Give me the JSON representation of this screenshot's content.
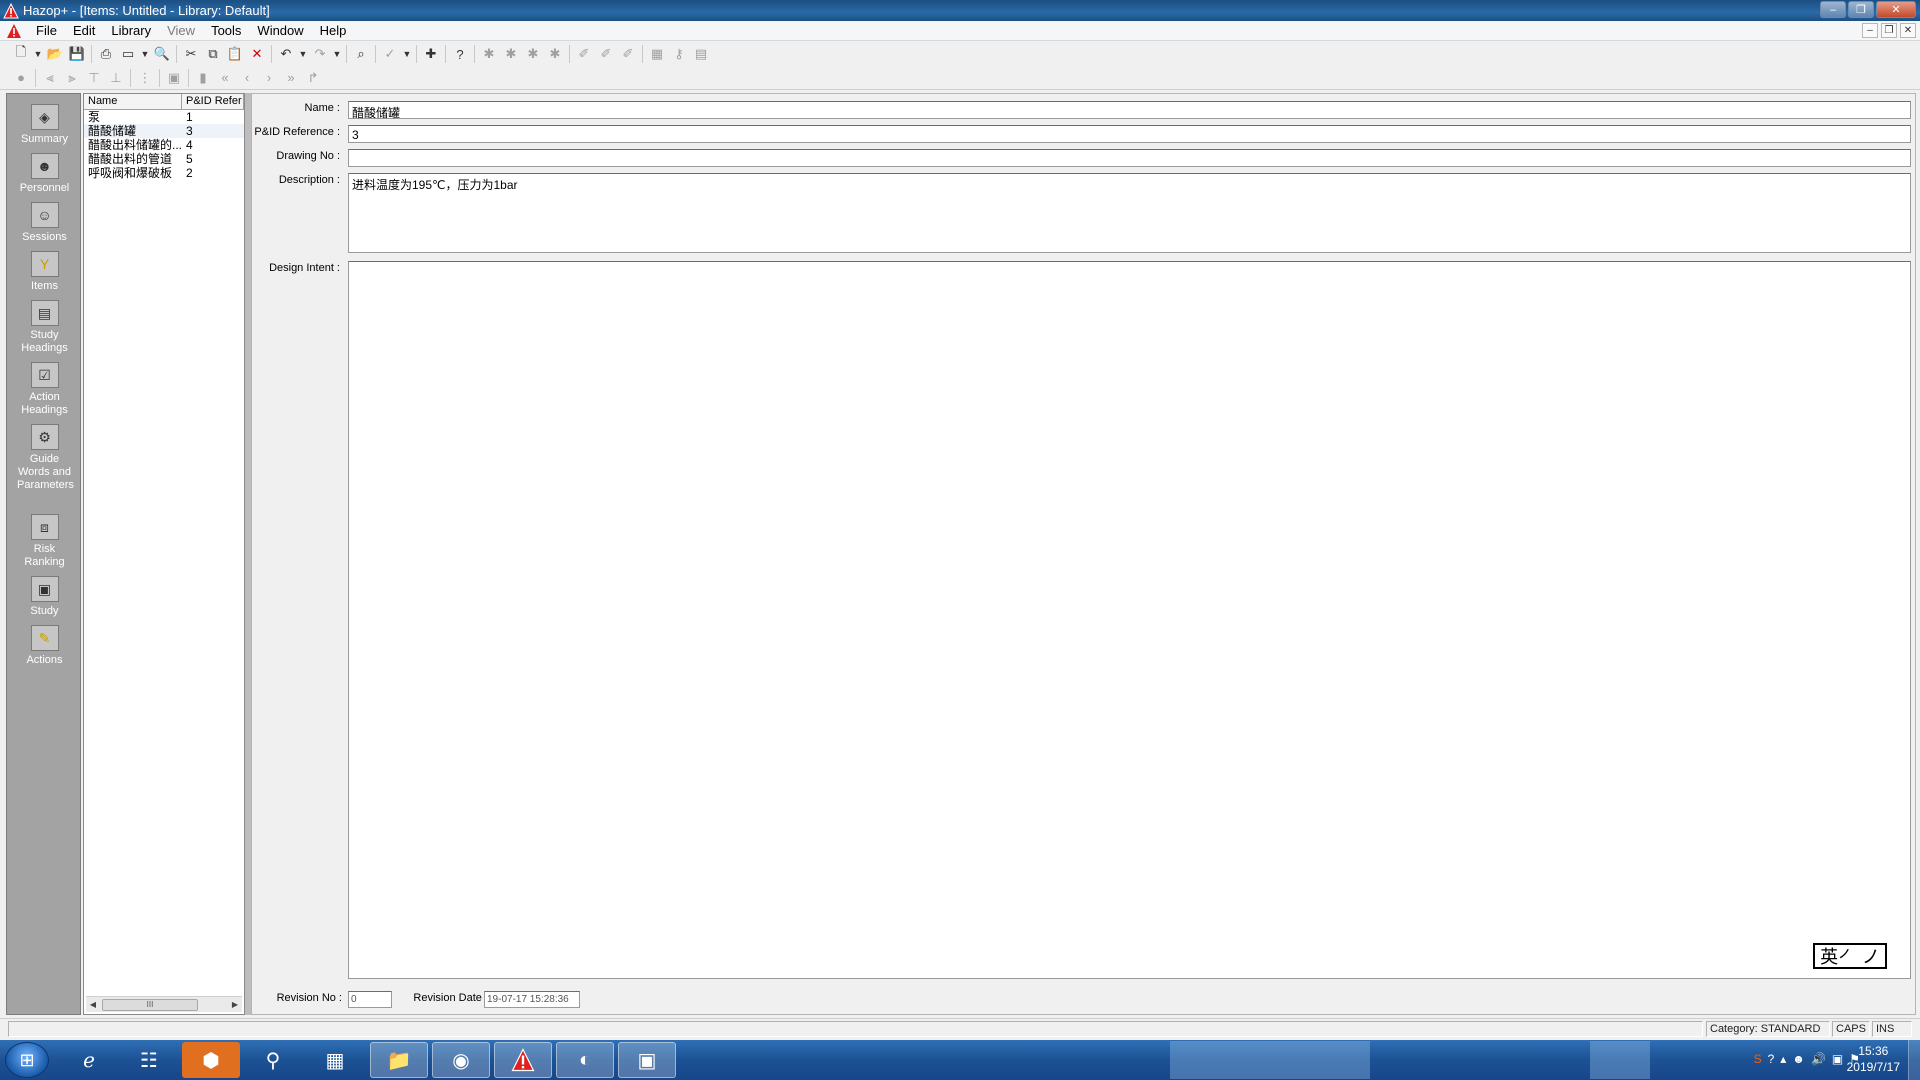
{
  "window": {
    "title": "Hazop+ - [Items: Untitled - Library: Default]",
    "controls": {
      "minimize": "–",
      "maximize": "❐",
      "close": "✕"
    }
  },
  "menu": {
    "items": [
      "File",
      "Edit",
      "Library",
      "View",
      "Tools",
      "Window",
      "Help"
    ]
  },
  "sidebar": {
    "items": [
      {
        "label": "Summary",
        "icon": "summary-icon",
        "glyph": "◈"
      },
      {
        "label": "Personnel",
        "icon": "personnel-icon",
        "glyph": "☻"
      },
      {
        "label": "Sessions",
        "icon": "sessions-icon",
        "glyph": "☺"
      },
      {
        "label": "Items",
        "icon": "items-icon",
        "glyph": "Y"
      },
      {
        "label": "Study Headings",
        "icon": "study-headings-icon",
        "glyph": "▤"
      },
      {
        "label": "Action Headings",
        "icon": "action-headings-icon",
        "glyph": "☑"
      },
      {
        "label": "Guide Words and Parameters",
        "icon": "guide-words-icon",
        "glyph": "⚙"
      },
      {
        "label": "Risk Ranking",
        "icon": "risk-ranking-icon",
        "glyph": "⧈"
      },
      {
        "label": "Study",
        "icon": "study-icon",
        "glyph": "▣"
      },
      {
        "label": "Actions",
        "icon": "actions-icon",
        "glyph": "✎"
      }
    ]
  },
  "list": {
    "columns": [
      "Name",
      "P&ID Refer"
    ],
    "rows": [
      {
        "name": "泵",
        "pid": "1"
      },
      {
        "name": "醋酸储罐",
        "pid": "3"
      },
      {
        "name": "醋酸出料储罐的...",
        "pid": "4"
      },
      {
        "name": "醋酸出料的管道",
        "pid": "5"
      },
      {
        "name": "呼吸阀和爆破板",
        "pid": "2"
      }
    ],
    "scroll_thumb": "III"
  },
  "form": {
    "name_label": "Name :",
    "name_value": "醋酸储罐",
    "pid_label": "P&ID Reference :",
    "pid_value": "3",
    "drawing_label": "Drawing No :",
    "drawing_value": "",
    "description_label": "Description :",
    "description_value": "进料温度为195℃，压力为1bar",
    "design_intent_label": "Design Intent :",
    "design_intent_value": "",
    "revision_no_label": "Revision No :",
    "revision_no_value": "0",
    "revision_date_label": "Revision Date :",
    "revision_date_value": "19-07-17 15:28:36",
    "ime_indicator": "英㇒ ノ"
  },
  "status": {
    "category": "Category: STANDARD",
    "caps": "CAPS",
    "ins": "INS"
  },
  "taskbar": {
    "clock_time": "15:36",
    "clock_date": "2019/7/17"
  }
}
